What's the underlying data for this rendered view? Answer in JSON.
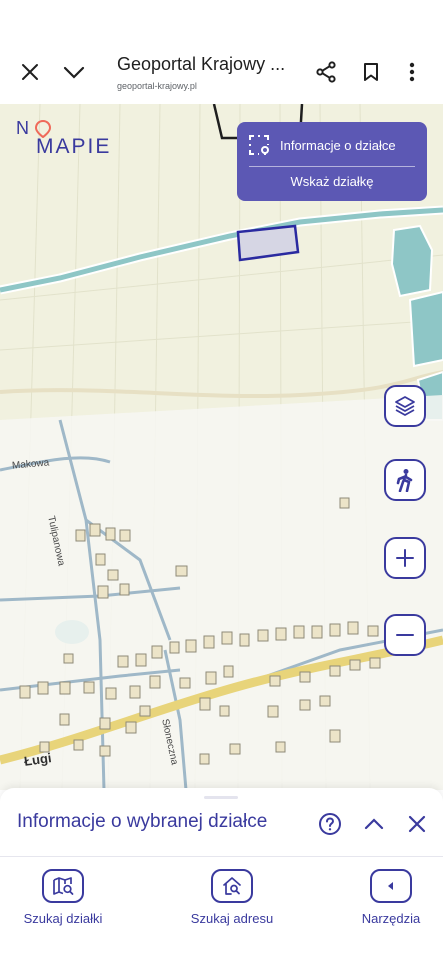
{
  "browser": {
    "title": "Geoportal Krajowy ...",
    "url": "geoportal-krajowy.pl",
    "icons": [
      "close-icon",
      "chevron-down-icon",
      "share-icon",
      "bookmark-icon",
      "more-vert-icon"
    ]
  },
  "map": {
    "logo_top": "N",
    "logo_bottom": "MAPIE",
    "info_panel": {
      "title": "Informacje o działce",
      "action": "Wskaż działkę"
    },
    "controls": [
      "layers-icon",
      "pedestrian-icon",
      "zoom-in-icon",
      "zoom-out-icon"
    ],
    "labels": {
      "makowa": "Makowa",
      "tulipanowa": "Tulipanowa",
      "lugi": "Ługi",
      "sloneczna": "Słoneczna"
    },
    "colors": {
      "accent": "#3a3a9e",
      "panel": "#5c58b4",
      "map_background": "#f1f1df",
      "water": "#8ec6c6"
    }
  },
  "sheet": {
    "title": "Informacje o wybranej działce"
  },
  "nav": {
    "items": [
      {
        "label": "Szukaj działki",
        "icon": "map-search-icon"
      },
      {
        "label": "Szukaj adresu",
        "icon": "home-search-icon"
      },
      {
        "label": "Narzędzia",
        "icon": "caret-left-icon"
      }
    ]
  }
}
